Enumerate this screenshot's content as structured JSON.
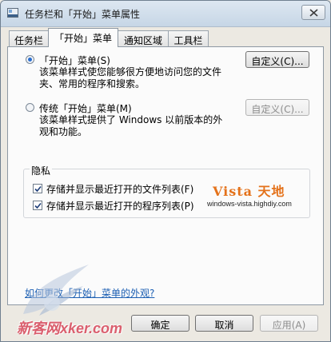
{
  "window": {
    "title": "任务栏和「开始」菜单属性",
    "close_symbol": "×"
  },
  "tabs": [
    {
      "label": "任务栏",
      "active": false
    },
    {
      "label": "「开始」菜单",
      "active": true
    },
    {
      "label": "通知区域",
      "active": false
    },
    {
      "label": "工具栏",
      "active": false
    }
  ],
  "start_menu_option": {
    "label": "「开始」菜单(S)",
    "description": "该菜单样式使您能够很方便地访问您的文件夹、常用的程序和搜索。",
    "selected": true,
    "customize_label": "自定义(C)..."
  },
  "classic_menu_option": {
    "label": "传统「开始」菜单(M)",
    "description": "该菜单样式提供了 Windows 以前版本的外观和功能。",
    "selected": false,
    "customize_label": "自定义(C)..."
  },
  "privacy": {
    "title": "隐私",
    "store_files_label": "存储并显示最近打开的文件列表(F)",
    "store_files_checked": true,
    "store_programs_label": "存储并显示最近打开的程序列表(P)",
    "store_programs_checked": true
  },
  "overlay_logo": {
    "title": "Vista 天地",
    "url": "windows-vista.highdiy.com"
  },
  "help_link": "如何更改「开始」菜单的外观?",
  "buttons": {
    "ok": "确定",
    "cancel": "取消",
    "apply": "应用(A)"
  },
  "watermark": {
    "text": "新客网xker.com"
  },
  "colors": {
    "accent": "#2a6fd0",
    "link": "#1c5fb3",
    "logo": "#e4721b",
    "watermark": "#d7475a"
  }
}
